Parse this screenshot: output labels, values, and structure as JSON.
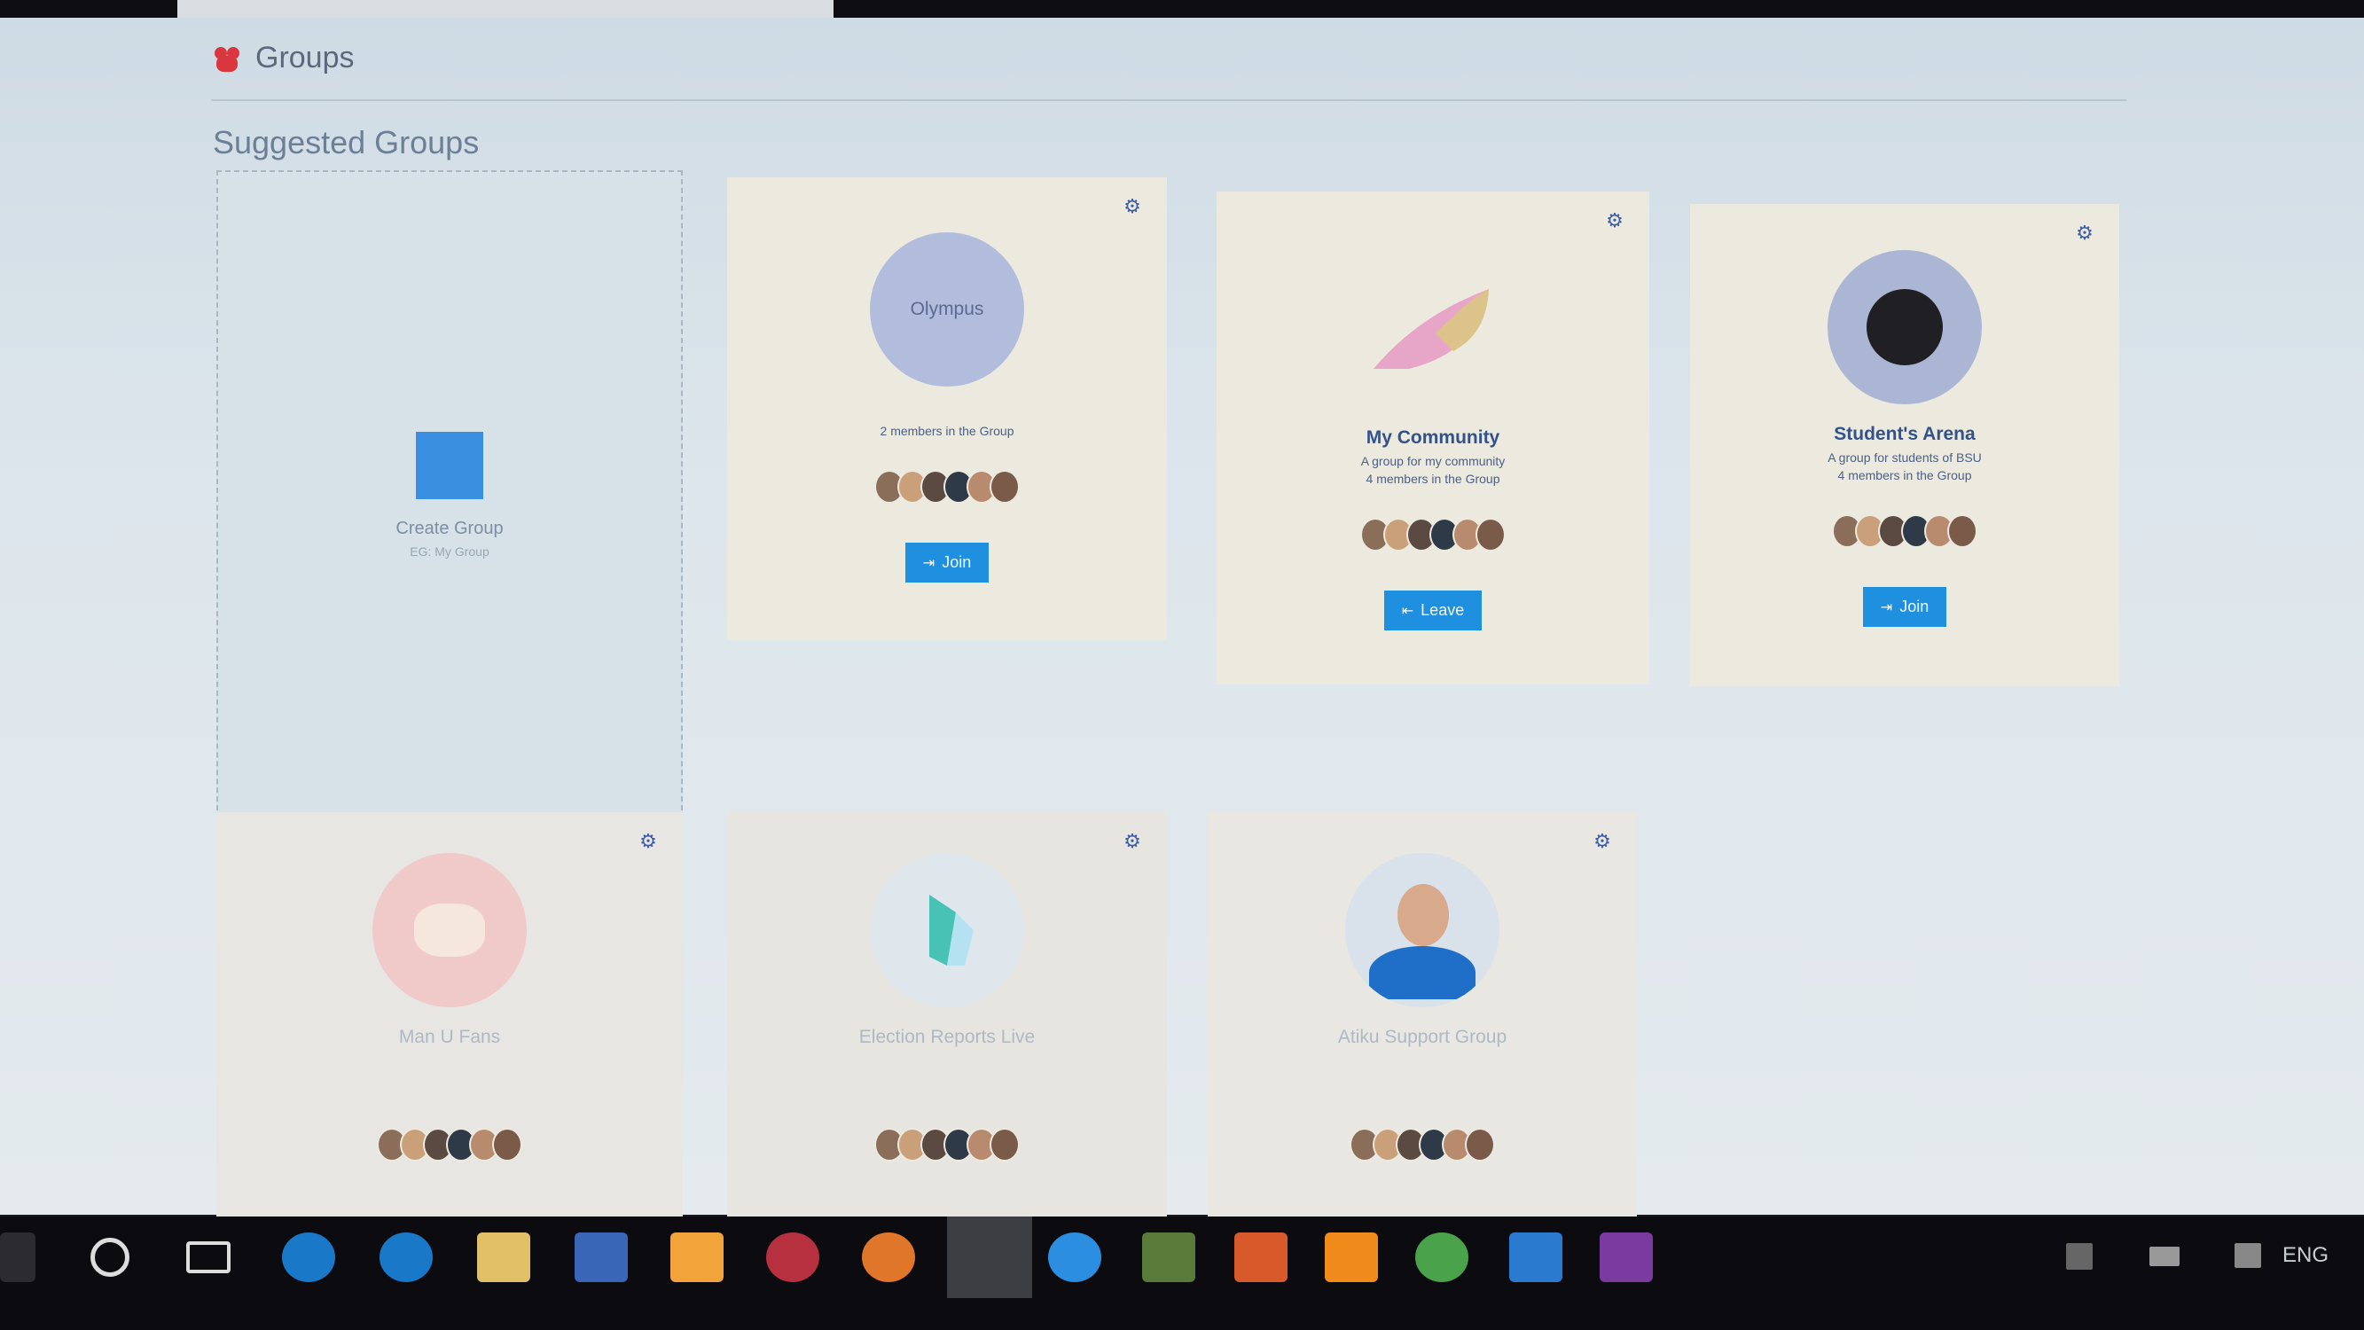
{
  "header": {
    "title": "Groups",
    "icon": "group-icon"
  },
  "section_title": "Suggested Groups",
  "create_group": {
    "label": "Create Group",
    "hint": "EG: My Group"
  },
  "groups": [
    {
      "name": "",
      "avatar_text": "Olympus",
      "description": "",
      "members": "2 members in the Group",
      "button": "Join"
    },
    {
      "name": "My Community",
      "avatar_text": "",
      "description": "A group for my community",
      "members": "4 members in the Group",
      "button": "Leave"
    },
    {
      "name": "Student's Arena",
      "avatar_text": "",
      "description": "A group for students of BSU",
      "members": "4 members in the Group",
      "button": "Join"
    },
    {
      "name": "Man U Fans",
      "avatar_text": "",
      "description": "",
      "members": "",
      "button": ""
    },
    {
      "name": "Election Reports Live",
      "avatar_text": "",
      "description": "",
      "members": "",
      "button": ""
    },
    {
      "name": "Atiku Support Group",
      "avatar_text": "",
      "description": "",
      "members": "",
      "button": ""
    }
  ],
  "taskbar": {
    "apps": [
      "start-icon",
      "cortana-icon",
      "task-view-icon",
      "sync-icon",
      "edge-icon",
      "file-explorer-icon",
      "store-icon",
      "paint-icon",
      "settings-icon",
      "firefox-icon",
      "chrome-canary-icon",
      "ie-icon",
      "git-icon",
      "matlab-icon",
      "vlc-icon",
      "chrome-icon",
      "vscode-icon",
      "photoshop-icon"
    ],
    "language": "ENG"
  },
  "colors": {
    "accent": "#1f8fe0",
    "header_icon": "#d9363e",
    "gear": "#3e5ea9"
  }
}
